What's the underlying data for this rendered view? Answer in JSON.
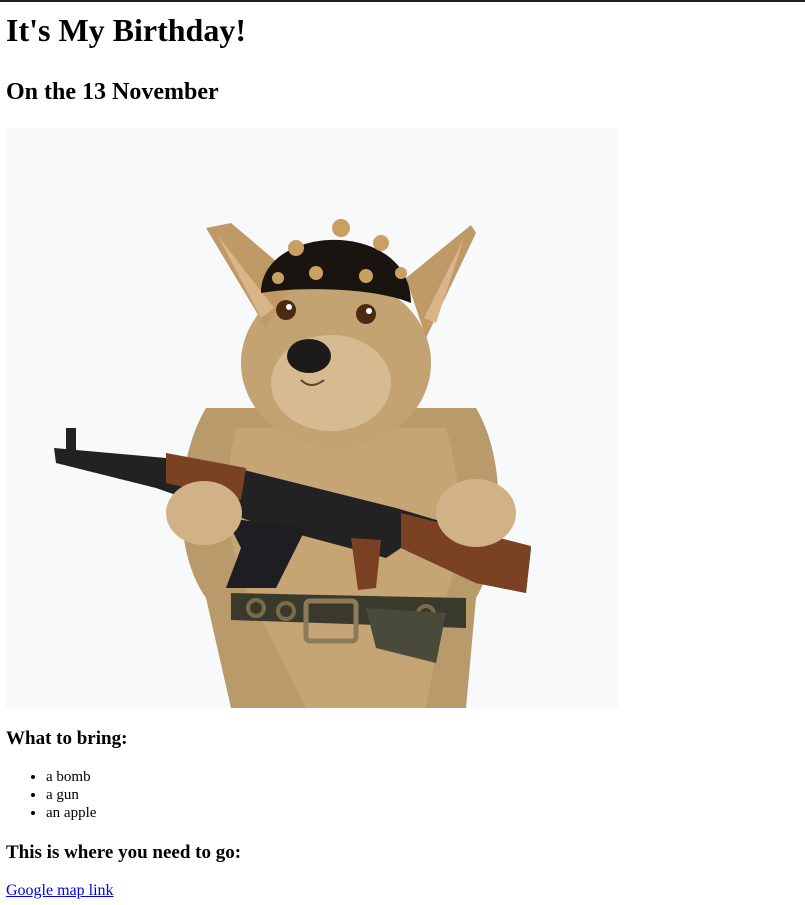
{
  "page": {
    "title": "It's My Birthday!",
    "subtitle": "On the 13 November",
    "photo_icon": "dog-with-bandana-and-rifle-illustration",
    "bring_heading": "What to bring:",
    "bring_items": [
      "a bomb",
      "a gun",
      "an apple"
    ],
    "go_heading": "This is where you need to go:",
    "map_link_label": "Google map link"
  },
  "colors": {
    "link": "#0000ee",
    "photo_bg": "#f8f9fb",
    "topbar": "#1f1f1f"
  }
}
